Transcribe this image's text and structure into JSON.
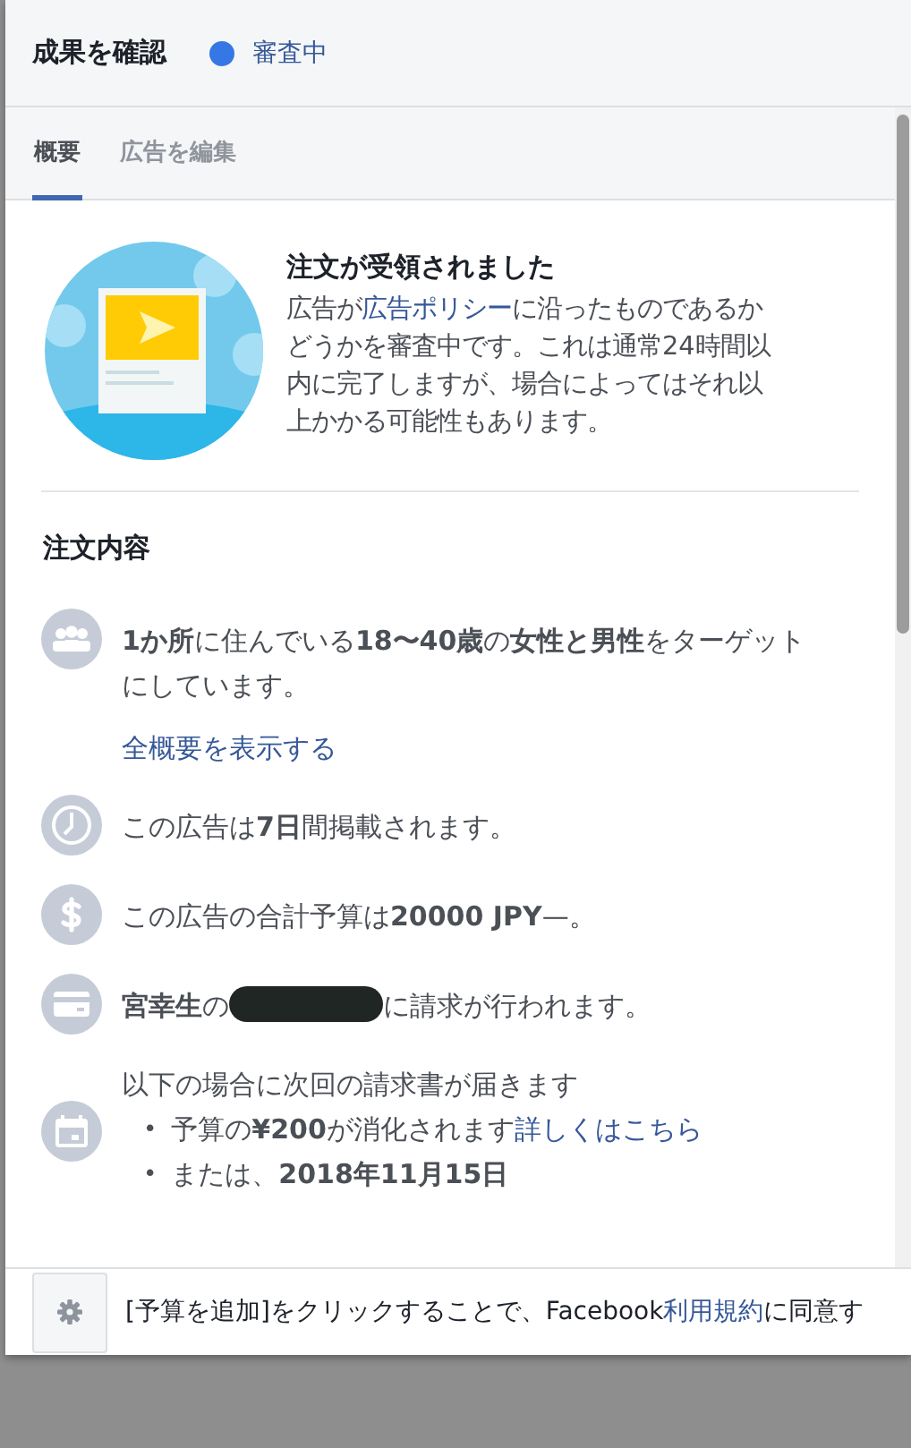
{
  "header": {
    "title": "成果を確認",
    "status": {
      "label": "審査中",
      "color": "#3578e5"
    }
  },
  "tabs": [
    {
      "label": "概要",
      "selected": true
    },
    {
      "label": "広告を編集",
      "selected": false
    }
  ],
  "notice": {
    "title": "注文が受領されました",
    "body_before": "広告が",
    "link": "広告ポリシー",
    "body_after": "に沿ったものであるかどうかを審査中です。これは通常24時間以内に完了しますが、場合によってはそれ以上かかる可能性もあります。"
  },
  "order": {
    "heading": "注文内容",
    "items": [
      {
        "kind": "audience",
        "text": "**1か所**に住んでいる**18〜40歳**の**女性と男性**をターゲットにしています。",
        "link": "全概要を表示する"
      },
      {
        "kind": "duration",
        "text": "この広告は**7日**間掲載されます。"
      },
      {
        "kind": "budget",
        "text": "この広告の合計予算は**20000 JPY**—。"
      },
      {
        "kind": "billing",
        "text": "**宮幸生**の",
        "redacted": true,
        "text_after": "に請求が行われます。"
      },
      {
        "kind": "invoice",
        "text": "以下の場合に次回の請求書が届きます",
        "bullets": [
          {
            "marker": "•",
            "text": "予算の**¥200**が消化されます",
            "link": "詳しくはこちら"
          },
          {
            "marker": "•",
            "text": "または、**2018年11月15日**"
          }
        ]
      }
    ]
  },
  "footer": {
    "text_before": "[予算を追加]をクリックすることで、Facebook",
    "link": "利用規約",
    "text_after": "に同意す"
  }
}
